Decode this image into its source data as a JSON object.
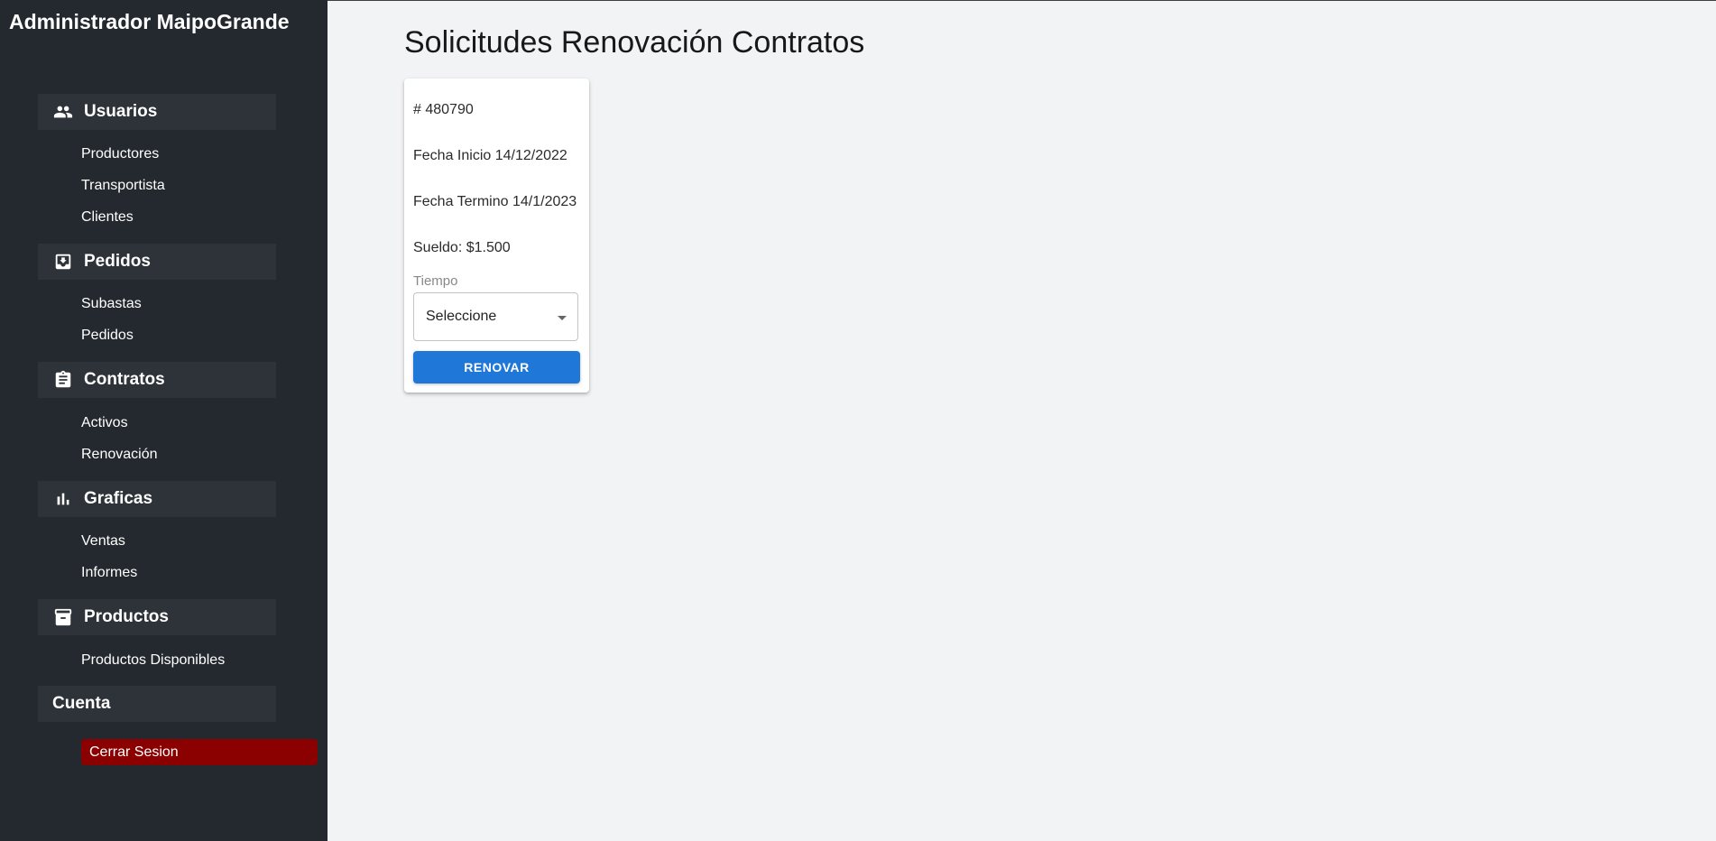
{
  "sidebar": {
    "title": "Administrador MaipoGrande",
    "groups": [
      {
        "label": "Usuarios",
        "icon": "users-icon",
        "items": [
          "Productores",
          "Transportista",
          "Clientes"
        ]
      },
      {
        "label": "Pedidos",
        "icon": "inbox-icon",
        "items": [
          "Subastas",
          "Pedidos"
        ]
      },
      {
        "label": "Contratos",
        "icon": "clipboard-icon",
        "items": [
          "Activos",
          "Renovación"
        ]
      },
      {
        "label": "Graficas",
        "icon": "bar-chart-icon",
        "items": [
          "Ventas",
          "Informes"
        ]
      },
      {
        "label": "Productos",
        "icon": "archive-icon",
        "items": [
          "Productos Disponibles"
        ]
      }
    ],
    "account": {
      "label": "Cuenta",
      "logout_label": "Cerrar Sesion"
    }
  },
  "main": {
    "title": "Solicitudes Renovación Contratos",
    "card": {
      "id_text": "# 480790",
      "start_text": "Fecha Inicio 14/12/2022",
      "end_text": "Fecha Termino 14/1/2023",
      "salary_text": "Sueldo: $1.500",
      "time_label": "Tiempo",
      "time_value": "Seleccione",
      "renew_label": "RENOVAR"
    }
  },
  "colors": {
    "sidebar_bg": "#23292e",
    "group_bg": "#2d3338",
    "logout_bg": "#8b0000",
    "primary": "#1f78d8",
    "page_bg": "#f2f3f5"
  }
}
